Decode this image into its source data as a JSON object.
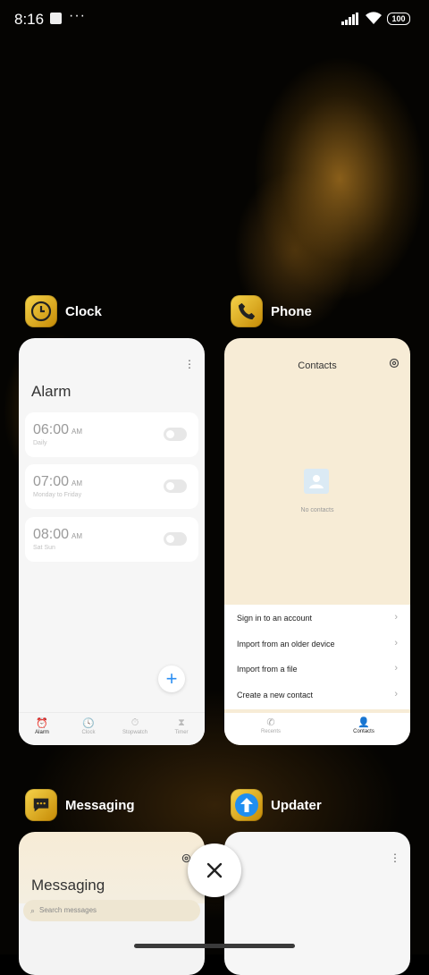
{
  "status": {
    "time": "8:16",
    "battery": "100"
  },
  "apps": {
    "clock": {
      "name": "Clock",
      "screen_title": "Alarm",
      "alarms": [
        {
          "time": "06:00",
          "ampm": "AM",
          "repeat": "Daily"
        },
        {
          "time": "07:00",
          "ampm": "AM",
          "repeat": "Monday to Friday"
        },
        {
          "time": "08:00",
          "ampm": "AM",
          "repeat": "Sat Sun"
        }
      ],
      "tabs": [
        "Alarm",
        "Clock",
        "Stopwatch",
        "Timer"
      ]
    },
    "phone": {
      "name": "Phone",
      "screen_title": "Contacts",
      "empty_text": "No contacts",
      "options": [
        "Sign in to an account",
        "Import from an older device",
        "Import from a file",
        "Create a new contact"
      ],
      "tabs": [
        "Recents",
        "Contacts"
      ]
    },
    "messaging": {
      "name": "Messaging",
      "screen_title": "Messaging",
      "search_placeholder": "Search messages"
    },
    "updater": {
      "name": "Updater"
    }
  },
  "colors": {
    "accent": "#2b8ef2",
    "app_icon_gold": "#e0ad1c",
    "phone_bg": "#f7ecd6"
  }
}
